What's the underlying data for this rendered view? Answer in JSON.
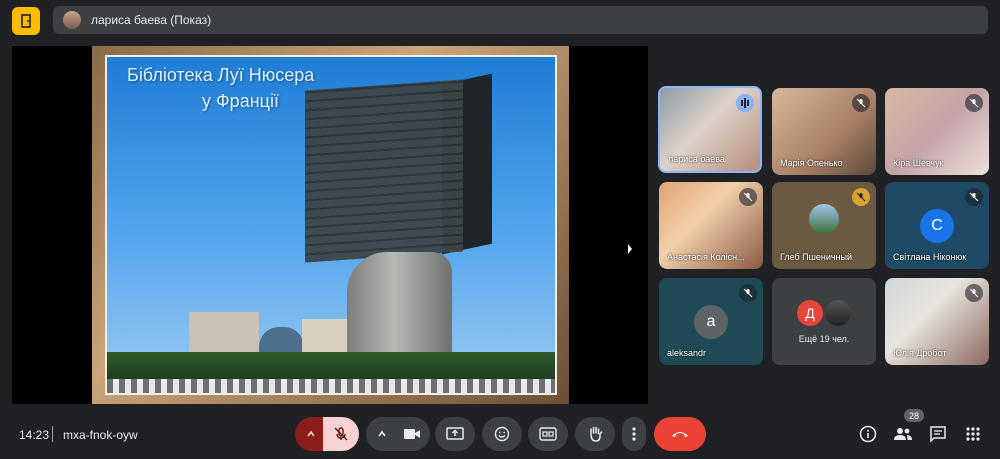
{
  "presenter_bar": {
    "name": "лариса баева (Показ)"
  },
  "slide": {
    "title_line1": "Бібліотека Луї Нюсера",
    "title_line2": "у Франції"
  },
  "participants": [
    {
      "name": "лариса баева",
      "state": "speaking"
    },
    {
      "name": "Марія Опенько",
      "state": "muted"
    },
    {
      "name": "Кіра Шевчук",
      "state": "muted"
    },
    {
      "name": "Анастасія Колісн...",
      "state": "muted"
    },
    {
      "name": "Глеб Пшеничный",
      "state": "muted"
    },
    {
      "name": "Світлана Ніконюк",
      "state": "muted",
      "initial": "С"
    },
    {
      "name": "aleksandr",
      "state": "muted",
      "initial": "a"
    },
    {
      "name": "Юлія Дробот",
      "state": "muted"
    }
  ],
  "more_tile": {
    "initial": "Д",
    "label": "Ещё 19 чел."
  },
  "bottom": {
    "time": "14:23",
    "meeting_code": "mxa-fnok-oyw",
    "participant_count": "28"
  },
  "colors": {
    "accent": "#8ab4f8",
    "end_call": "#ea4335",
    "warning": "#fbbc04"
  }
}
